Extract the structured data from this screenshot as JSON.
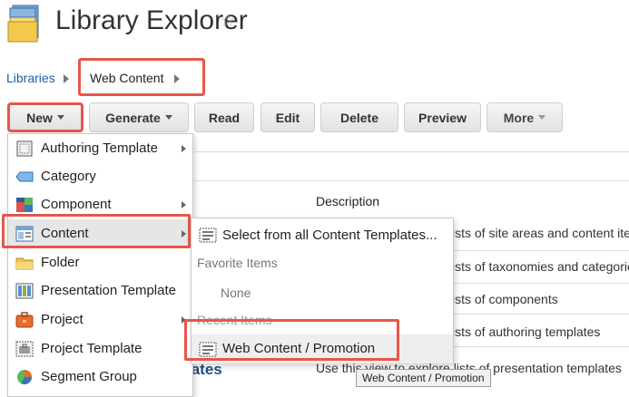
{
  "header": {
    "title": "Library Explorer",
    "app_icon": "library-explorer-icon",
    "favorite_icon": "star-outline-icon"
  },
  "breadcrumb": {
    "items": [
      "Libraries",
      "Web Content"
    ]
  },
  "toolbar": {
    "new_label": "New",
    "generate_label": "Generate",
    "read_label": "Read",
    "edit_label": "Edit",
    "delete_label": "Delete",
    "preview_label": "Preview",
    "more_label": "More"
  },
  "table": {
    "description_header": "Description",
    "descriptions": [
      "ists of site areas and content iter",
      "ists of taxonomies and categorie",
      "ists of components",
      "ists of authoring templates"
    ],
    "row5_heading": "lates",
    "row5_description": "Use this view to explore lists of presentation templates"
  },
  "new_menu": {
    "items": [
      {
        "label": "Authoring Template",
        "icon": "authoring-template-icon",
        "submenu": true
      },
      {
        "label": "Category",
        "icon": "category-icon",
        "submenu": false
      },
      {
        "label": "Component",
        "icon": "component-icon",
        "submenu": true
      },
      {
        "label": "Content",
        "icon": "content-icon",
        "submenu": true
      },
      {
        "label": "Folder",
        "icon": "folder-icon",
        "submenu": false
      },
      {
        "label": "Presentation Template",
        "icon": "presentation-template-icon",
        "submenu": false
      },
      {
        "label": "Project",
        "icon": "project-icon",
        "submenu": true
      },
      {
        "label": "Project Template",
        "icon": "project-template-icon",
        "submenu": false
      },
      {
        "label": "Segment Group",
        "icon": "segment-group-icon",
        "submenu": false
      }
    ]
  },
  "content_submenu": {
    "select_all": "Select from all Content Templates...",
    "favorites_header": "Favorite Items",
    "favorites_none": "None",
    "recent_header": "Recent Items",
    "recent_item": "Web Content / Promotion"
  },
  "tooltip": "Web Content / Promotion",
  "colors": {
    "highlight": "#e8554a",
    "link": "#1f5ea8"
  }
}
